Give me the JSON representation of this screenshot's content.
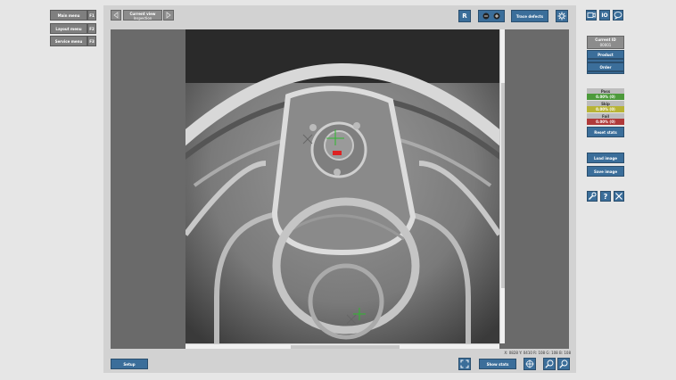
{
  "left_menu": {
    "items": [
      {
        "label": "Main menu",
        "key": "F1"
      },
      {
        "label": "Layout menu",
        "key": "F2"
      },
      {
        "label": "Service menu",
        "key": "F3"
      }
    ]
  },
  "top_bar": {
    "current_view_label": "Current view",
    "current_view_value": "Inspection",
    "r_label": "R",
    "trace_defects_label": "Trace defects"
  },
  "right_panel": {
    "current_id_label": "Current ID",
    "current_id_value": "00001",
    "product_label": "Product",
    "order_label": "Order",
    "stats": {
      "pass_label": "Pass",
      "pass_value": "0.00% (0)",
      "skip_label": "Skip",
      "skip_value": "0.00% (0)",
      "fail_label": "Fail",
      "fail_value": "0.00% (0)"
    },
    "reset_stats_label": "Reset stats",
    "load_image_label": "Load image",
    "save_image_label": "Save image"
  },
  "bottom_bar": {
    "setup_label": "Setup",
    "show_stats_label": "Show stats",
    "status_text": "X: 0828 Y: 0410  R: 108 G: 108 B: 108"
  },
  "colors": {
    "accent": "#3b6e9a",
    "pass": "#4c9a3a",
    "skip": "#b8b436",
    "fail": "#b03a3a"
  },
  "icons": [
    "arrow-left-icon",
    "arrow-right-icon",
    "circle-minus-icon",
    "circle-plus-icon",
    "settings-icon",
    "camera-icon",
    "io-icon",
    "message-icon",
    "wrench-icon",
    "help-icon",
    "close-icon",
    "fullscreen-icon",
    "crosshair-icon",
    "zoom-in-icon",
    "zoom-out-icon"
  ]
}
